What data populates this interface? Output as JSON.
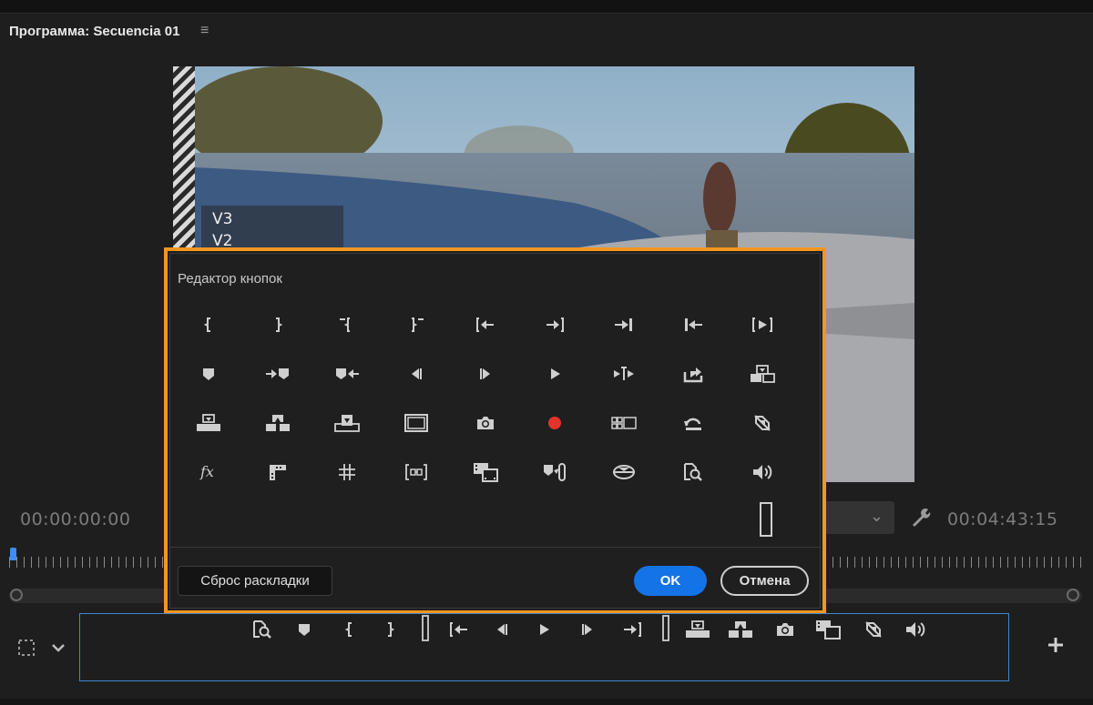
{
  "panel": {
    "title": "Программа: Secuencia 01",
    "menu_icon": "hamburger-menu-icon"
  },
  "video": {
    "tracks": [
      "V3",
      "V2"
    ]
  },
  "timecodes": {
    "current": "00:00:00:00",
    "duration": "00:04:43:15"
  },
  "dialog": {
    "title": "Редактор кнопок",
    "reset_label": "Сброс раскладки",
    "ok_label": "OK",
    "cancel_label": "Отмена",
    "icons": [
      [
        "mark-in-icon",
        "mark-out-icon",
        "clear-in-icon",
        "clear-out-icon",
        "go-to-in-icon",
        "go-to-out-icon",
        "go-to-next-edit-icon",
        "go-to-previous-edit-icon",
        "play-in-to-out-icon"
      ],
      [
        "add-marker-icon",
        "go-to-next-marker-icon",
        "go-to-previous-marker-icon",
        "step-back-icon",
        "step-forward-icon",
        "play-icon",
        "play-around-icon",
        "export-frame-icon",
        "insert-icon"
      ],
      [
        "lift-icon",
        "extract-icon",
        "overwrite-icon",
        "safe-margins-icon",
        "camera-icon",
        "record-icon",
        "multi-camera-icon",
        "loop-icon",
        "toggle-proxies-icon"
      ],
      [
        "fx-icon",
        "trim-icon",
        "comparison-view-icon",
        "vr-video-icon",
        "show-rulers-icon",
        "link-marker-icon",
        "global-fx-mute-icon",
        "zoom-search-icon",
        "volume-icon"
      ],
      [
        "spacer-icon"
      ]
    ]
  },
  "button_bar": {
    "icons": [
      "zoom-search-icon",
      "add-marker-icon",
      "mark-in-icon",
      "mark-out-icon",
      "spacer-icon",
      "go-to-in-icon",
      "step-back-icon",
      "play-icon",
      "step-forward-icon",
      "go-to-out-icon",
      "spacer-icon",
      "lift-icon",
      "extract-icon",
      "camera-icon",
      "show-rulers-icon",
      "toggle-proxies-icon",
      "volume-icon"
    ]
  }
}
